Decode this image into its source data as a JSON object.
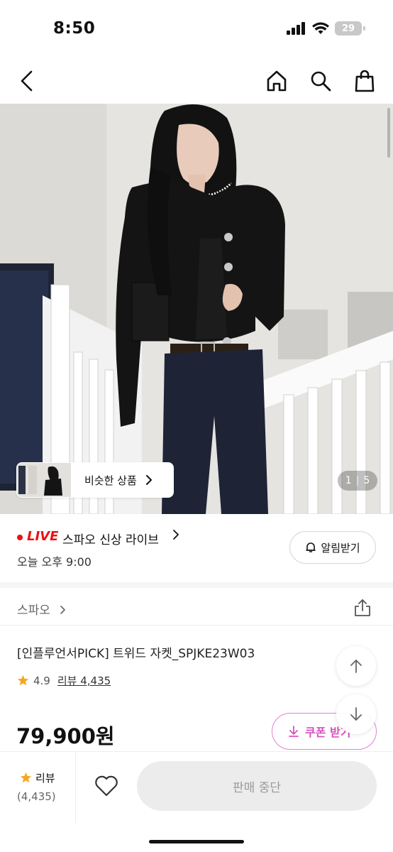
{
  "status_bar": {
    "time": "8:50",
    "battery": "29"
  },
  "gallery": {
    "similar_label": "비슷한 상품",
    "page_current": "1",
    "page_total": "5"
  },
  "live": {
    "tag": "LIVE",
    "title": "스파오 신상 라이브",
    "time": "오늘 오후 9:00",
    "alarm_label": "알림받기"
  },
  "brand": {
    "name": "스파오"
  },
  "product": {
    "name": "[인플루언서PICK] 트위드 자켓_SPJKE23W03",
    "rating": "4.9",
    "review_link": "리뷰 4,435",
    "price": "79,900원",
    "coupon_label": "쿠폰 받기"
  },
  "bottom_bar": {
    "review_label": "리뷰",
    "review_count": "(4,435)",
    "buy_label": "판매 중단"
  },
  "colors": {
    "live_red": "#ee1111",
    "coupon_pink": "#d94fc0",
    "star": "#f5a623"
  }
}
